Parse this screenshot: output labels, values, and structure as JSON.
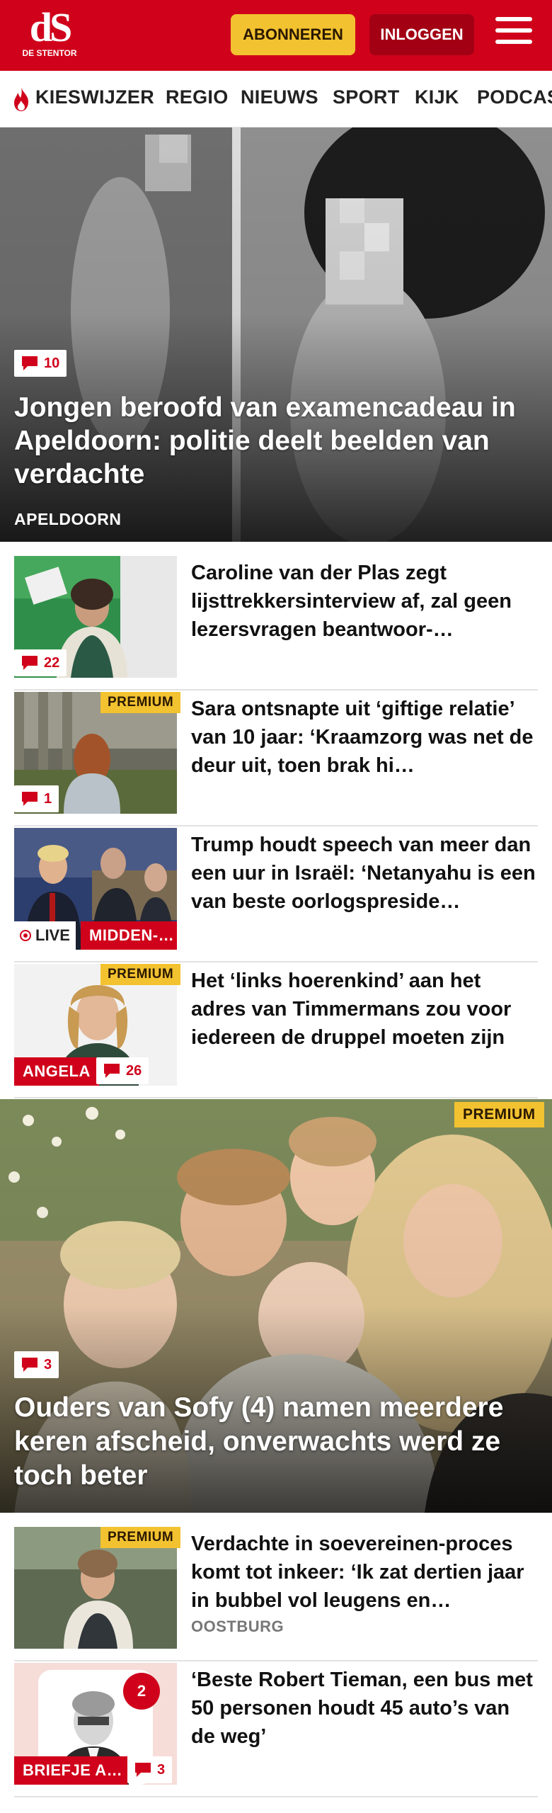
{
  "header": {
    "logo_mark": "dS",
    "logo_sub": "DE STENTOR",
    "subscribe_label": "ABONNEREN",
    "login_label": "INLOGGEN",
    "brand_color": "#d0021b",
    "accent_color": "#f2c230"
  },
  "nav": {
    "items": [
      "KIESWIJZER",
      "REGIO",
      "NIEUWS",
      "SPORT",
      "KIJK",
      "PODCAS"
    ]
  },
  "hero": {
    "comments": "10",
    "title": "Jongen beroofd van examencadeau in Apeldoorn: politie deelt beelden van verdachte",
    "tag": "APELDOORN"
  },
  "articles": [
    {
      "title": "Caroline van der Plas zegt lijsttrekkersinterview af, zal geen lezersvragen beantwoor-…",
      "comments": "22"
    },
    {
      "title": "Sara ontsnapte uit ‘giftige relatie’ van 10 jaar: ‘Kraamzorg was net de deur uit, toen brak hi…",
      "premium": "PREMIUM",
      "comments": "1"
    },
    {
      "title": "Trump houdt speech van meer dan een uur in Israël: ‘Netanyahu is een van beste oorlogspreside…",
      "live": "LIVE",
      "section": "MIDDEN-…"
    },
    {
      "title": "Het ‘links hoerenkind’ aan het adres van Timmermans zou voor iedereen de druppel moeten zijn",
      "premium": "PREMIUM",
      "section": "ANGELA",
      "comments": "26"
    }
  ],
  "hero2": {
    "premium": "PREMIUM",
    "comments": "3",
    "title": "Ouders van Sofy (4) namen meerdere keren afscheid, onverwachts werd ze toch beter"
  },
  "articles2": [
    {
      "title": "Verdachte in soevereinen-proces komt tot inkeer: ‘Ik zat dertien jaar in bubbel vol leugens en…",
      "premium": "PREMIUM",
      "sub": "OOSTBURG"
    },
    {
      "title": "‘Beste Robert Tieman, een bus met 50 personen houdt 45 auto’s van de weg’",
      "section": "BRIEFJE A…",
      "comments": "3",
      "badge_number": "2"
    }
  ]
}
